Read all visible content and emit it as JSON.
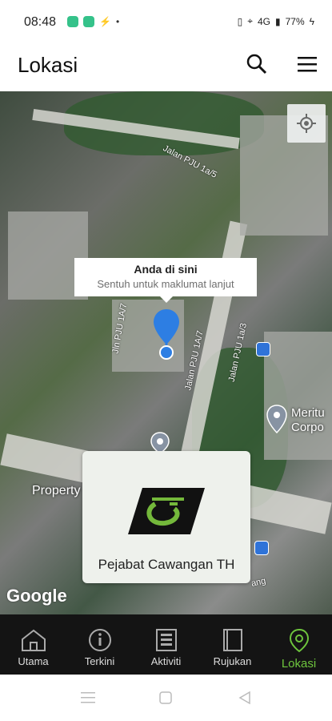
{
  "status": {
    "time": "08:48",
    "battery": "77%",
    "network": "4G"
  },
  "header": {
    "title": "Lokasi"
  },
  "map": {
    "callout_title": "Anda di sini",
    "callout_subtitle": "Sentuh untuk maklumat lanjut",
    "road_labels": [
      "Jalan PJU 1a/5",
      "Jln PJU 1A/7",
      "Jalan PJU 1A/7",
      "Jalan PJU 1a/3",
      "ang"
    ],
    "poi_property": "Property",
    "poi_meritus": "Meritu Corpo",
    "google": "Google"
  },
  "card": {
    "label": "Pejabat Cawangan TH",
    "logo_color": "#74b83b"
  },
  "navbar": {
    "items": [
      {
        "label": "Utama",
        "icon": "home-icon"
      },
      {
        "label": "Terkini",
        "icon": "info-icon"
      },
      {
        "label": "Aktiviti",
        "icon": "activity-icon"
      },
      {
        "label": "Rujukan",
        "icon": "book-icon"
      },
      {
        "label": "Lokasi",
        "icon": "location-icon"
      }
    ],
    "active": "Lokasi"
  },
  "colors": {
    "active": "#6ec53d",
    "pin": "#2d7ee3"
  }
}
